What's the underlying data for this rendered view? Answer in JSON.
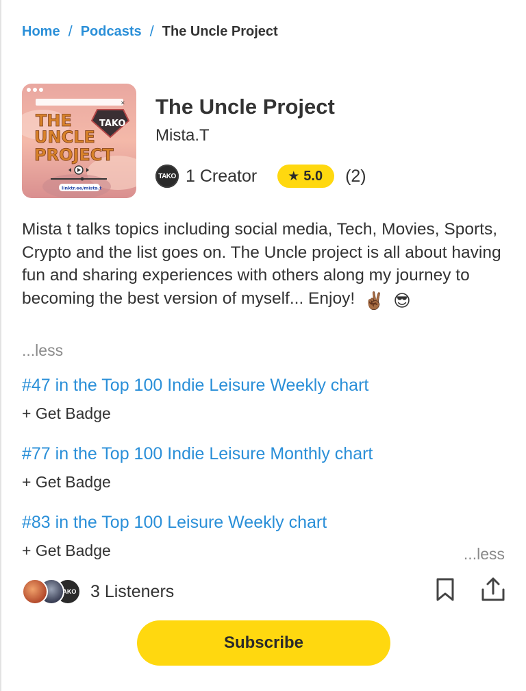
{
  "breadcrumb": {
    "home": "Home",
    "podcasts": "Podcasts",
    "current": "The Uncle Project",
    "separator": "/"
  },
  "podcast": {
    "title": "The Uncle Project",
    "author": "Mista.T",
    "creators_label": "1 Creator",
    "creator_avatar_text": "TAKO",
    "rating": "5.0",
    "rating_count": "(2)",
    "cover": {
      "title_lines": [
        "THE",
        "UNCLE",
        "PROJECT"
      ],
      "brand": "TAKO",
      "url": "linktr.ee/mista.t"
    }
  },
  "description": {
    "text": "Mista t talks topics including social media, Tech, Movies, Sports, Crypto and the list goes on. The Uncle project is all about having fun and sharing experiences with others along my journey to becoming the best version of myself... Enjoy!",
    "emojis": [
      "✌🏾",
      "😎"
    ],
    "less_label": "...less"
  },
  "charts": [
    {
      "rank_text": "#47 in the Top 100 Indie Leisure Weekly chart",
      "badge_label": "+ Get Badge"
    },
    {
      "rank_text": "#77 in the Top 100 Indie Leisure Monthly chart",
      "badge_label": "+ Get Badge"
    },
    {
      "rank_text": "#83 in the Top 100 Leisure Weekly chart",
      "badge_label": "+ Get Badge"
    }
  ],
  "charts_less_label": "...less",
  "listeners": {
    "label": "3 Listeners",
    "avatar3_text": "TAKO"
  },
  "actions": {
    "bookmark_icon": "bookmark-icon",
    "share_icon": "share-icon"
  },
  "subscribe_label": "Subscribe",
  "colors": {
    "link": "#2a8fd8",
    "accent": "#ffd80f",
    "text": "#333333",
    "muted": "#8a8a8a"
  }
}
